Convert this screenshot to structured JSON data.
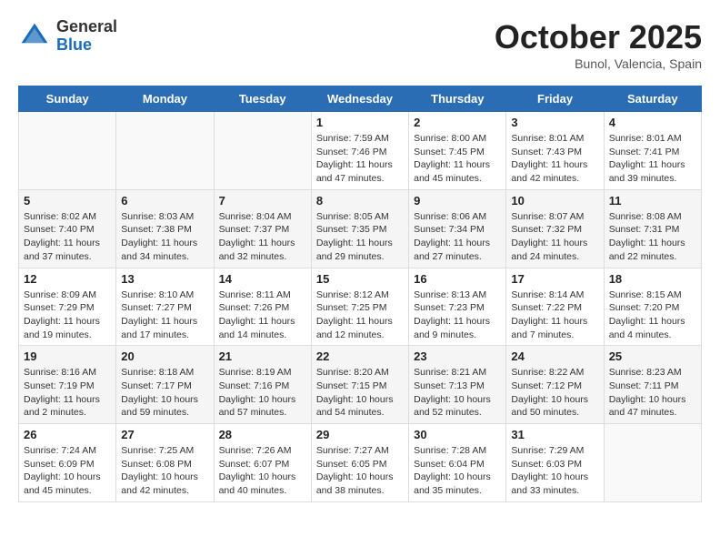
{
  "header": {
    "logo_general": "General",
    "logo_blue": "Blue",
    "month": "October 2025",
    "location": "Bunol, Valencia, Spain"
  },
  "weekdays": [
    "Sunday",
    "Monday",
    "Tuesday",
    "Wednesday",
    "Thursday",
    "Friday",
    "Saturday"
  ],
  "weeks": [
    [
      {
        "day": "",
        "sunrise": "",
        "sunset": "",
        "daylight": ""
      },
      {
        "day": "",
        "sunrise": "",
        "sunset": "",
        "daylight": ""
      },
      {
        "day": "",
        "sunrise": "",
        "sunset": "",
        "daylight": ""
      },
      {
        "day": "1",
        "sunrise": "Sunrise: 7:59 AM",
        "sunset": "Sunset: 7:46 PM",
        "daylight": "Daylight: 11 hours and 47 minutes."
      },
      {
        "day": "2",
        "sunrise": "Sunrise: 8:00 AM",
        "sunset": "Sunset: 7:45 PM",
        "daylight": "Daylight: 11 hours and 45 minutes."
      },
      {
        "day": "3",
        "sunrise": "Sunrise: 8:01 AM",
        "sunset": "Sunset: 7:43 PM",
        "daylight": "Daylight: 11 hours and 42 minutes."
      },
      {
        "day": "4",
        "sunrise": "Sunrise: 8:01 AM",
        "sunset": "Sunset: 7:41 PM",
        "daylight": "Daylight: 11 hours and 39 minutes."
      }
    ],
    [
      {
        "day": "5",
        "sunrise": "Sunrise: 8:02 AM",
        "sunset": "Sunset: 7:40 PM",
        "daylight": "Daylight: 11 hours and 37 minutes."
      },
      {
        "day": "6",
        "sunrise": "Sunrise: 8:03 AM",
        "sunset": "Sunset: 7:38 PM",
        "daylight": "Daylight: 11 hours and 34 minutes."
      },
      {
        "day": "7",
        "sunrise": "Sunrise: 8:04 AM",
        "sunset": "Sunset: 7:37 PM",
        "daylight": "Daylight: 11 hours and 32 minutes."
      },
      {
        "day": "8",
        "sunrise": "Sunrise: 8:05 AM",
        "sunset": "Sunset: 7:35 PM",
        "daylight": "Daylight: 11 hours and 29 minutes."
      },
      {
        "day": "9",
        "sunrise": "Sunrise: 8:06 AM",
        "sunset": "Sunset: 7:34 PM",
        "daylight": "Daylight: 11 hours and 27 minutes."
      },
      {
        "day": "10",
        "sunrise": "Sunrise: 8:07 AM",
        "sunset": "Sunset: 7:32 PM",
        "daylight": "Daylight: 11 hours and 24 minutes."
      },
      {
        "day": "11",
        "sunrise": "Sunrise: 8:08 AM",
        "sunset": "Sunset: 7:31 PM",
        "daylight": "Daylight: 11 hours and 22 minutes."
      }
    ],
    [
      {
        "day": "12",
        "sunrise": "Sunrise: 8:09 AM",
        "sunset": "Sunset: 7:29 PM",
        "daylight": "Daylight: 11 hours and 19 minutes."
      },
      {
        "day": "13",
        "sunrise": "Sunrise: 8:10 AM",
        "sunset": "Sunset: 7:27 PM",
        "daylight": "Daylight: 11 hours and 17 minutes."
      },
      {
        "day": "14",
        "sunrise": "Sunrise: 8:11 AM",
        "sunset": "Sunset: 7:26 PM",
        "daylight": "Daylight: 11 hours and 14 minutes."
      },
      {
        "day": "15",
        "sunrise": "Sunrise: 8:12 AM",
        "sunset": "Sunset: 7:25 PM",
        "daylight": "Daylight: 11 hours and 12 minutes."
      },
      {
        "day": "16",
        "sunrise": "Sunrise: 8:13 AM",
        "sunset": "Sunset: 7:23 PM",
        "daylight": "Daylight: 11 hours and 9 minutes."
      },
      {
        "day": "17",
        "sunrise": "Sunrise: 8:14 AM",
        "sunset": "Sunset: 7:22 PM",
        "daylight": "Daylight: 11 hours and 7 minutes."
      },
      {
        "day": "18",
        "sunrise": "Sunrise: 8:15 AM",
        "sunset": "Sunset: 7:20 PM",
        "daylight": "Daylight: 11 hours and 4 minutes."
      }
    ],
    [
      {
        "day": "19",
        "sunrise": "Sunrise: 8:16 AM",
        "sunset": "Sunset: 7:19 PM",
        "daylight": "Daylight: 11 hours and 2 minutes."
      },
      {
        "day": "20",
        "sunrise": "Sunrise: 8:18 AM",
        "sunset": "Sunset: 7:17 PM",
        "daylight": "Daylight: 10 hours and 59 minutes."
      },
      {
        "day": "21",
        "sunrise": "Sunrise: 8:19 AM",
        "sunset": "Sunset: 7:16 PM",
        "daylight": "Daylight: 10 hours and 57 minutes."
      },
      {
        "day": "22",
        "sunrise": "Sunrise: 8:20 AM",
        "sunset": "Sunset: 7:15 PM",
        "daylight": "Daylight: 10 hours and 54 minutes."
      },
      {
        "day": "23",
        "sunrise": "Sunrise: 8:21 AM",
        "sunset": "Sunset: 7:13 PM",
        "daylight": "Daylight: 10 hours and 52 minutes."
      },
      {
        "day": "24",
        "sunrise": "Sunrise: 8:22 AM",
        "sunset": "Sunset: 7:12 PM",
        "daylight": "Daylight: 10 hours and 50 minutes."
      },
      {
        "day": "25",
        "sunrise": "Sunrise: 8:23 AM",
        "sunset": "Sunset: 7:11 PM",
        "daylight": "Daylight: 10 hours and 47 minutes."
      }
    ],
    [
      {
        "day": "26",
        "sunrise": "Sunrise: 7:24 AM",
        "sunset": "Sunset: 6:09 PM",
        "daylight": "Daylight: 10 hours and 45 minutes."
      },
      {
        "day": "27",
        "sunrise": "Sunrise: 7:25 AM",
        "sunset": "Sunset: 6:08 PM",
        "daylight": "Daylight: 10 hours and 42 minutes."
      },
      {
        "day": "28",
        "sunrise": "Sunrise: 7:26 AM",
        "sunset": "Sunset: 6:07 PM",
        "daylight": "Daylight: 10 hours and 40 minutes."
      },
      {
        "day": "29",
        "sunrise": "Sunrise: 7:27 AM",
        "sunset": "Sunset: 6:05 PM",
        "daylight": "Daylight: 10 hours and 38 minutes."
      },
      {
        "day": "30",
        "sunrise": "Sunrise: 7:28 AM",
        "sunset": "Sunset: 6:04 PM",
        "daylight": "Daylight: 10 hours and 35 minutes."
      },
      {
        "day": "31",
        "sunrise": "Sunrise: 7:29 AM",
        "sunset": "Sunset: 6:03 PM",
        "daylight": "Daylight: 10 hours and 33 minutes."
      },
      {
        "day": "",
        "sunrise": "",
        "sunset": "",
        "daylight": ""
      }
    ]
  ]
}
